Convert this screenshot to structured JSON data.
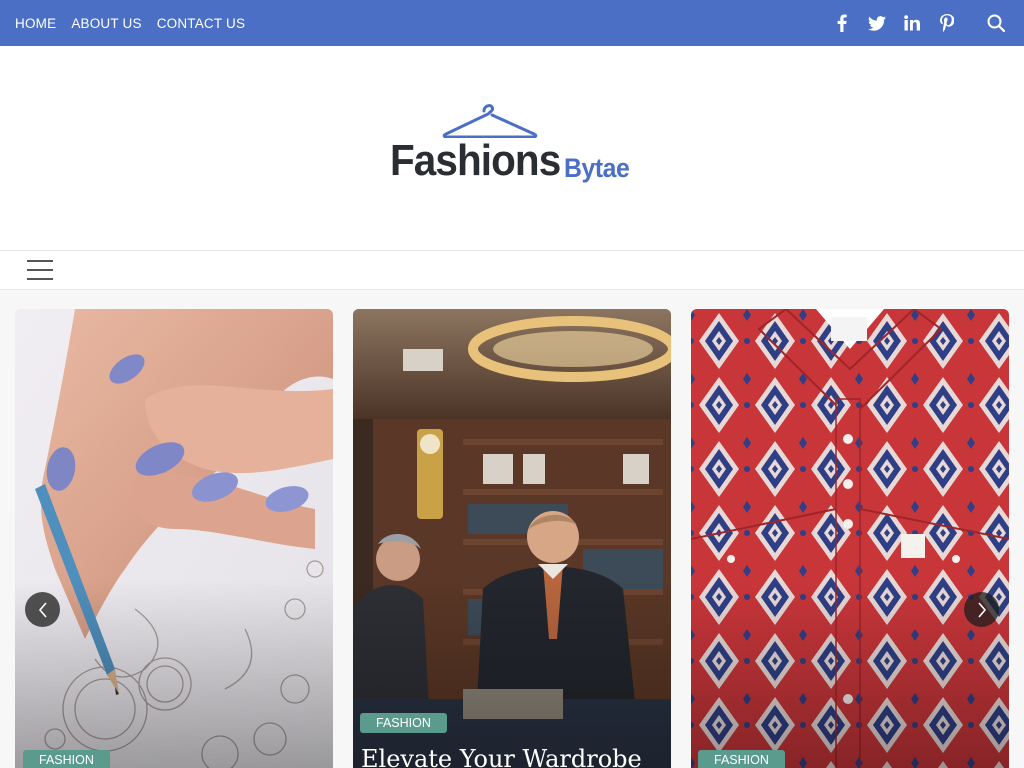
{
  "topbar": {
    "nav": [
      "HOME",
      "ABOUT US",
      "CONTACT US"
    ],
    "social_icons": [
      "facebook-icon",
      "twitter-icon",
      "linkedin-icon",
      "pinterest-icon"
    ],
    "search_icon": "search-icon",
    "bg_color": "#4a6fc4"
  },
  "logo": {
    "main": "Fashions",
    "sub": "Bytae",
    "main_color": "#2a2e33",
    "accent_color": "#4a6fc4"
  },
  "menu": {
    "icon": "hamburger-menu-icon"
  },
  "slider": {
    "prev_icon": "chevron-left-icon",
    "next_icon": "chevron-right-icon",
    "cards": [
      {
        "category": "FASHION",
        "title": "",
        "image": "hand-sketching-jewelry-image"
      },
      {
        "category": "FASHION",
        "title": "Elevate Your Wardrobe",
        "image": "tailor-shop-image"
      },
      {
        "category": "FASHION",
        "title": "",
        "image": "red-patterned-shirt-image"
      }
    ],
    "badge_color": "#5a9b8e"
  }
}
